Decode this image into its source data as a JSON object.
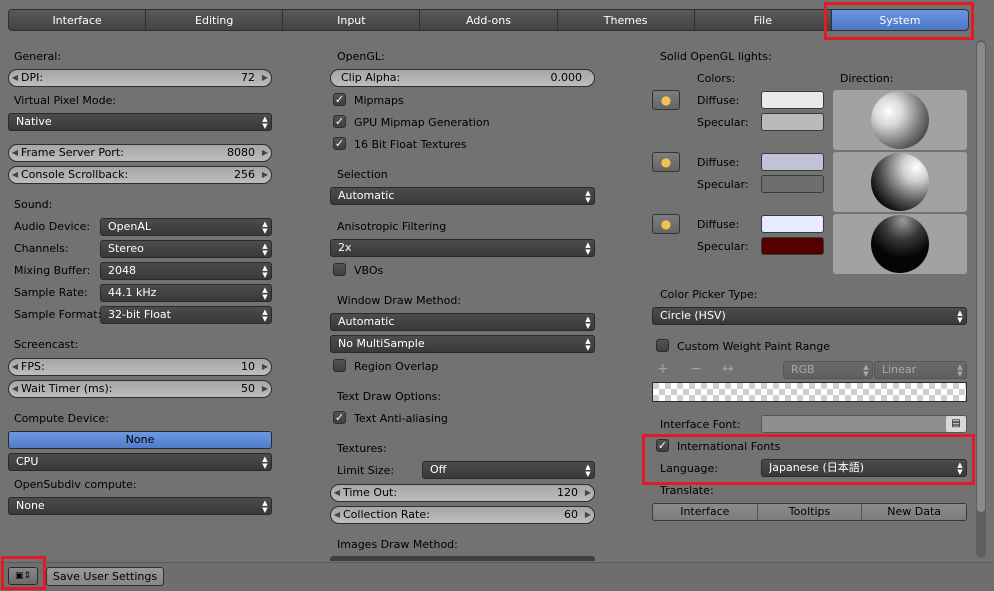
{
  "tabs": [
    "Interface",
    "Editing",
    "Input",
    "Add-ons",
    "Themes",
    "File",
    "System"
  ],
  "active_tab": "System",
  "col1": {
    "general_label": "General:",
    "dpi": {
      "label": "DPI:",
      "value": "72"
    },
    "virtual_pixel_label": "Virtual Pixel Mode:",
    "virtual_pixel_value": "Native",
    "frame_server_port": {
      "label": "Frame Server Port:",
      "value": "8080"
    },
    "console_scrollback": {
      "label": "Console Scrollback:",
      "value": "256"
    },
    "sound_label": "Sound:",
    "audio_device": {
      "label": "Audio Device:",
      "value": "OpenAL"
    },
    "channels": {
      "label": "Channels:",
      "value": "Stereo"
    },
    "mixing_buffer": {
      "label": "Mixing Buffer:",
      "value": "2048"
    },
    "sample_rate": {
      "label": "Sample Rate:",
      "value": "44.1 kHz"
    },
    "sample_format": {
      "label": "Sample Format:",
      "value": "32-bit Float"
    },
    "screencast_label": "Screencast:",
    "fps": {
      "label": "FPS:",
      "value": "10"
    },
    "wait_timer": {
      "label": "Wait Timer (ms):",
      "value": "50"
    },
    "compute_device_label": "Compute Device:",
    "compute_none": "None",
    "compute_cpu": "CPU",
    "opensubdiv_label": "OpenSubdiv compute:",
    "opensubdiv_value": "None"
  },
  "col2": {
    "opengl_label": "OpenGL:",
    "clip_alpha": {
      "label": "Clip Alpha:",
      "value": "0.000"
    },
    "mipmaps": "Mipmaps",
    "gpu_mipmap": "GPU Mipmap Generation",
    "float_textures": "16 Bit Float Textures",
    "selection_label": "Selection",
    "selection_value": "Automatic",
    "aniso_label": "Anisotropic Filtering",
    "aniso_value": "2x",
    "vbos": "VBOs",
    "window_draw_label": "Window Draw Method:",
    "window_draw_value": "Automatic",
    "multisample_value": "No MultiSample",
    "region_overlap": "Region Overlap",
    "text_draw_label": "Text Draw Options:",
    "text_antialias": "Text Anti-aliasing",
    "textures_label": "Textures:",
    "limit_size_label": "Limit Size:",
    "limit_size_value": "Off",
    "time_out": {
      "label": "Time Out:",
      "value": "120"
    },
    "collection_rate": {
      "label": "Collection Rate:",
      "value": "60"
    },
    "images_draw_label": "Images Draw Method:"
  },
  "col3": {
    "solid_lights_label": "Solid OpenGL lights:",
    "colors_label": "Colors:",
    "direction_label": "Direction:",
    "diffuse_label": "Diffuse:",
    "specular_label": "Specular:",
    "lights": [
      {
        "diffuse": "#e9e9e9",
        "specular": "#bababa"
      },
      {
        "diffuse": "#c0c3d6",
        "specular": "#6e6e6e"
      },
      {
        "diffuse": "#e7ebff",
        "specular": "#550000"
      }
    ],
    "color_picker_label": "Color Picker Type:",
    "color_picker_value": "Circle (HSV)",
    "custom_weight": "Custom Weight Paint Range",
    "ramp_mode": "RGB",
    "ramp_interp": "Linear",
    "interface_font_label": "Interface Font:",
    "international_fonts": "International Fonts",
    "language_label": "Language:",
    "language_value": "Japanese (日本語)",
    "translate_label": "Translate:",
    "translate_buttons": [
      "Interface",
      "Tooltips",
      "New Data"
    ]
  },
  "footer": {
    "save_label": "Save User Settings"
  },
  "colors": {
    "highlight": "#e21b25",
    "accent": "#5a86d5"
  }
}
